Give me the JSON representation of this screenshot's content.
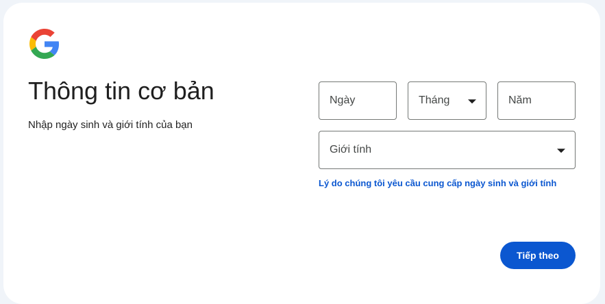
{
  "brand": {
    "logo_icon": "google-g-icon",
    "colors": {
      "blue": "#4285f4",
      "red": "#ea4335",
      "yellow": "#fbbc05",
      "green": "#34a853"
    }
  },
  "header": {
    "title": "Thông tin cơ bản",
    "subtitle": "Nhập ngày sinh và giới tính của bạn"
  },
  "form": {
    "day_placeholder": "Ngày",
    "month_placeholder": "Tháng",
    "year_placeholder": "Năm",
    "gender_placeholder": "Giới tính",
    "why_link": "Lý do chúng tôi yêu cầu cung cấp ngày sinh và giới tính"
  },
  "actions": {
    "next_label": "Tiếp theo",
    "accent": "#0b57d0"
  }
}
